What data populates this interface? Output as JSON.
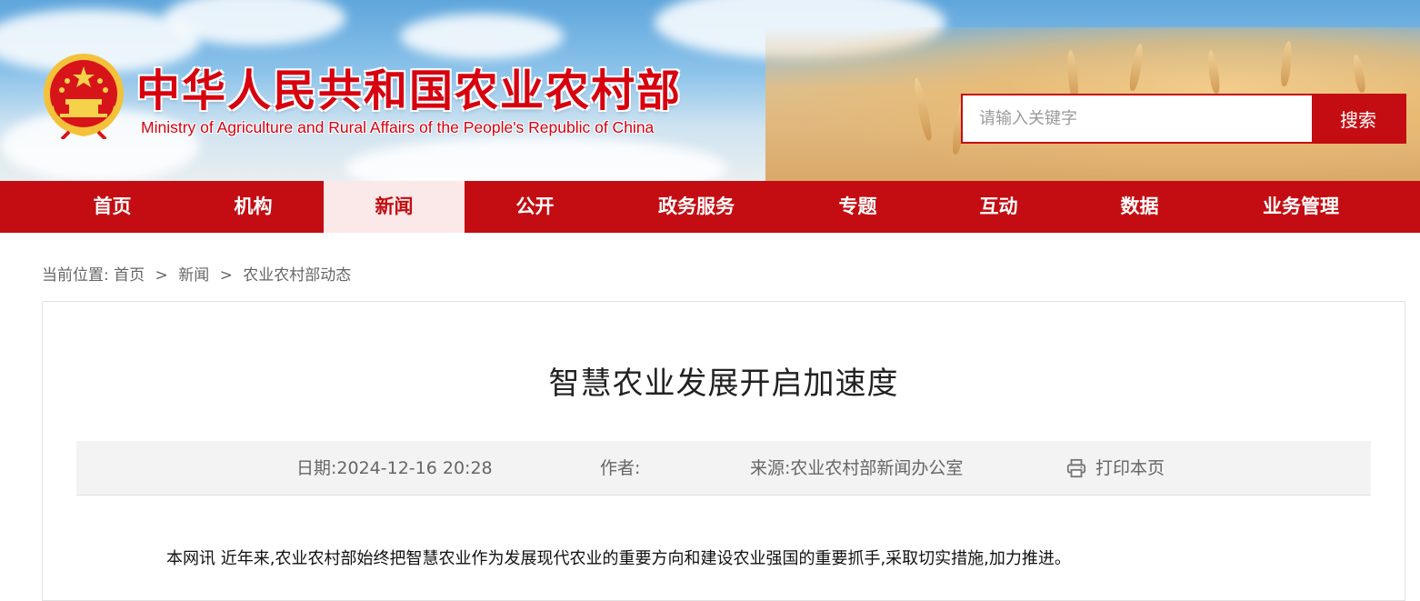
{
  "header": {
    "site_title": "中华人民共和国农业农村部",
    "site_subtitle": "Ministry of Agriculture and Rural Affairs of the People's Republic of China",
    "emblem_icon": "national-emblem-icon"
  },
  "search": {
    "placeholder": "请输入关键字",
    "value": "",
    "button_label": "搜索"
  },
  "nav": {
    "items": [
      {
        "label": "首页",
        "active": false
      },
      {
        "label": "机构",
        "active": false
      },
      {
        "label": "新闻",
        "active": true
      },
      {
        "label": "公开",
        "active": false
      },
      {
        "label": "政务服务",
        "active": false
      },
      {
        "label": "专题",
        "active": false
      },
      {
        "label": "互动",
        "active": false
      },
      {
        "label": "数据",
        "active": false
      },
      {
        "label": "业务管理",
        "active": false
      }
    ]
  },
  "breadcrumb": {
    "prefix": "当前位置:",
    "items": [
      "首页",
      "新闻",
      "农业农村部动态"
    ],
    "separator": ">"
  },
  "article": {
    "title": "智慧农业发展开启加速度",
    "meta": {
      "date_label": "日期:",
      "date_value": "2024-12-16 20:28",
      "author_label": "作者:",
      "author_value": "",
      "source_label": "来源:",
      "source_value": "农业农村部新闻办公室",
      "print_label": "打印本页",
      "print_icon": "printer-icon"
    },
    "body_first_line": "本网讯  近年来,农业农村部始终把智慧农业作为发展现代农业的重要方向和建设农业强国的重要抓手,采取切实措施,加力推进。"
  },
  "colors": {
    "brand_red": "#c30d12",
    "title_red": "#d7000f",
    "nav_active_bg": "#fbe8e8",
    "meta_bg": "#f3f3f3"
  }
}
